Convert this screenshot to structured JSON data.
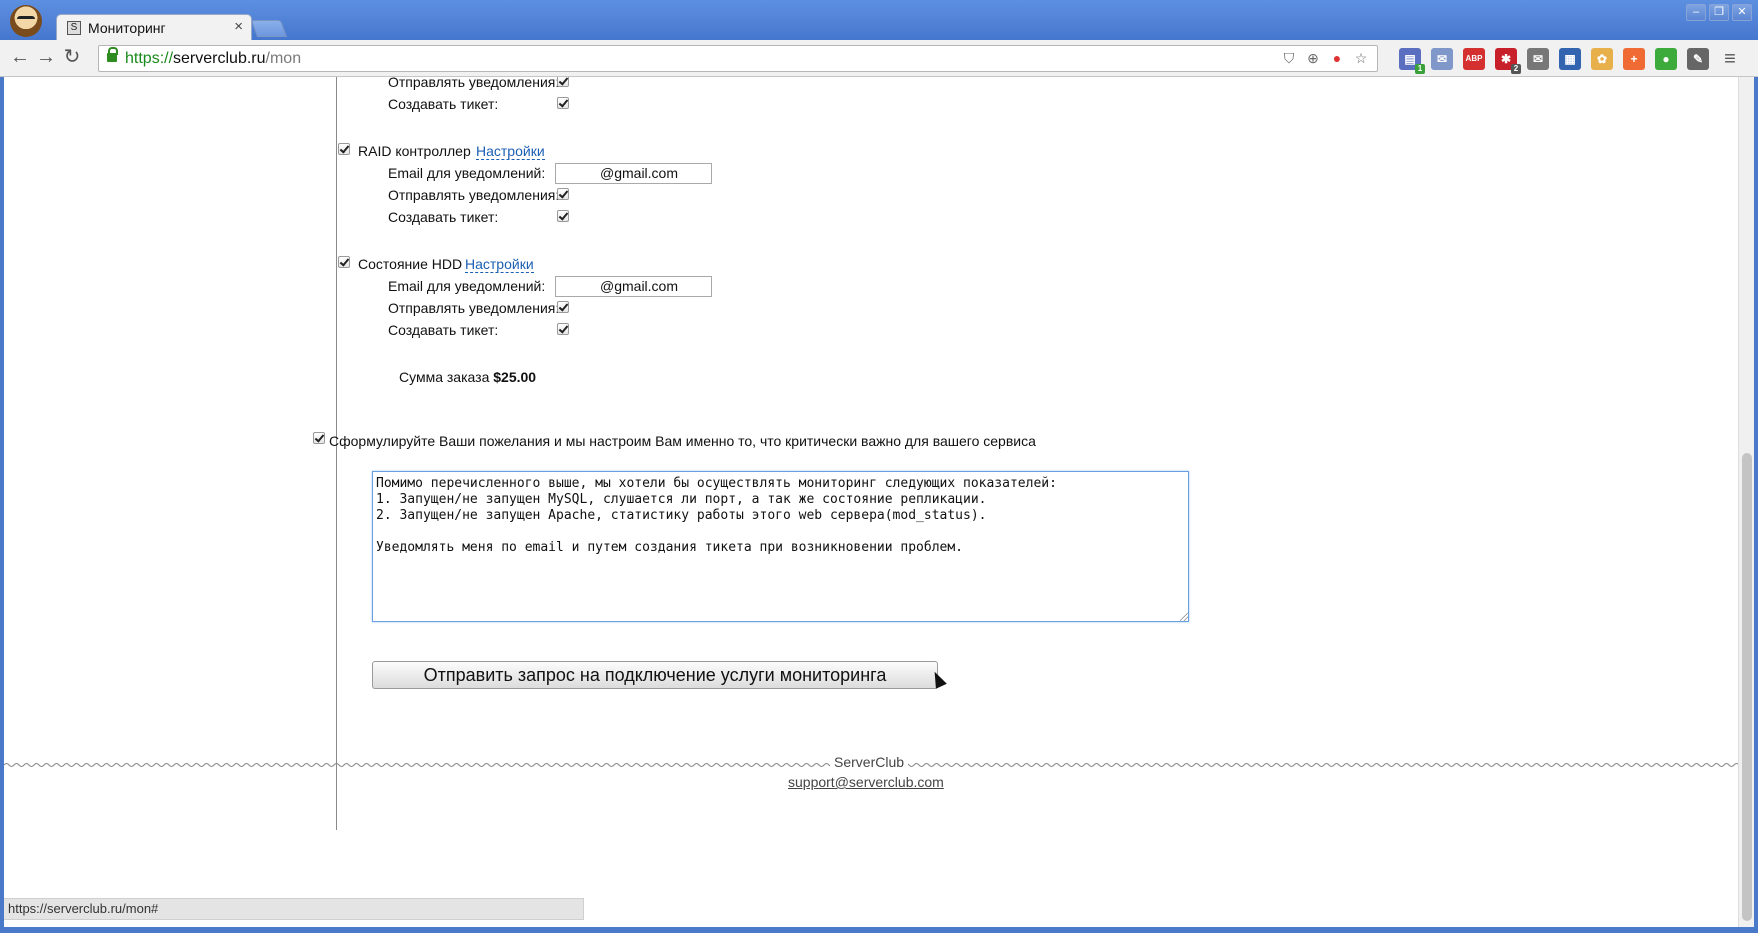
{
  "browser": {
    "tab_title": "Мониторинг",
    "tab_close": "×",
    "url_scheme": "https://",
    "url_host": "serverclub.ru",
    "url_path": "/mon",
    "status_url": "https://serverclub.ru/mon#",
    "window_buttons": [
      "–",
      "❐",
      "✕"
    ],
    "nav": {
      "back": "←",
      "forward": "→",
      "reload": "↻"
    },
    "omnibox_icons": [
      "shield-icon",
      "zoom-icon",
      "extension-icon",
      "star-icon"
    ],
    "extensions": [
      {
        "name": "calendar-ext-icon",
        "glyph": "▤",
        "color": "#5a6fbf",
        "badge": "1",
        "badge_color": "#3aa03a"
      },
      {
        "name": "mail-ext-icon",
        "glyph": "✉",
        "color": "#7f97c9",
        "badge": "",
        "badge_color": ""
      },
      {
        "name": "adblock-ext-icon",
        "glyph": "ABP",
        "color": "#d43030",
        "badge": "",
        "badge_color": ""
      },
      {
        "name": "lastpass-ext-icon",
        "glyph": "✱",
        "color": "#c8202a",
        "badge": "2",
        "badge_color": "#555"
      },
      {
        "name": "gmail-ext-icon",
        "glyph": "✉",
        "color": "#777",
        "badge": "",
        "badge_color": ""
      },
      {
        "name": "calculator-ext-icon",
        "glyph": "▦",
        "color": "#3264b0",
        "badge": "",
        "badge_color": ""
      },
      {
        "name": "flower-ext-icon",
        "glyph": "✿",
        "color": "#e8b04a",
        "badge": "",
        "badge_color": ""
      },
      {
        "name": "plus-ext-icon",
        "glyph": "+",
        "color": "#f06a33",
        "badge": "",
        "badge_color": ""
      },
      {
        "name": "evernote-ext-icon",
        "glyph": "●",
        "color": "#3cab3c",
        "badge": "",
        "badge_color": ""
      },
      {
        "name": "tools-ext-icon",
        "glyph": "✎",
        "color": "#666",
        "badge": "",
        "badge_color": ""
      },
      {
        "name": "menu-icon",
        "glyph": "≡",
        "color": "#555",
        "badge": "",
        "badge_color": ""
      }
    ]
  },
  "labels": {
    "email": "Email для уведомлений:",
    "notify": "Отправлять уведомления:",
    "ticket": "Создавать тикет:",
    "settings": "Настройки"
  },
  "top_group": {
    "notify_checked": true,
    "ticket_checked": true
  },
  "services": [
    {
      "name": "RAID контроллер",
      "checked": true,
      "email": "@gmail.com",
      "notify": true,
      "ticket": true
    },
    {
      "name": "Состояние HDD",
      "checked": true,
      "email": "@gmail.com",
      "notify": true,
      "ticket": true
    }
  ],
  "order_sum": {
    "label": "Сумма заказа",
    "value": "$25.00"
  },
  "wishes": {
    "checked": true,
    "label": "Сформулируйте Ваши пожелания и мы настроим Вам именно то, что критически важно для вашего сервиса",
    "text": "Помимо перечисленного выше, мы хотели бы осуществлять мониторинг следующих показателей:\n1. Запущен/не запущен MySQL, слушается ли порт, а так же состояние репликации.\n2. Запущен/не запущен Apache, статистику работы этого web сервера(mod_status).\n\nУведомлять меня по email и путем создания тикета при возникновении проблем."
  },
  "submit_label": "Отправить запрос на подключение услуги мониторинга",
  "footer": {
    "brand": "ServerClub",
    "email": "support@serverclub.com"
  }
}
